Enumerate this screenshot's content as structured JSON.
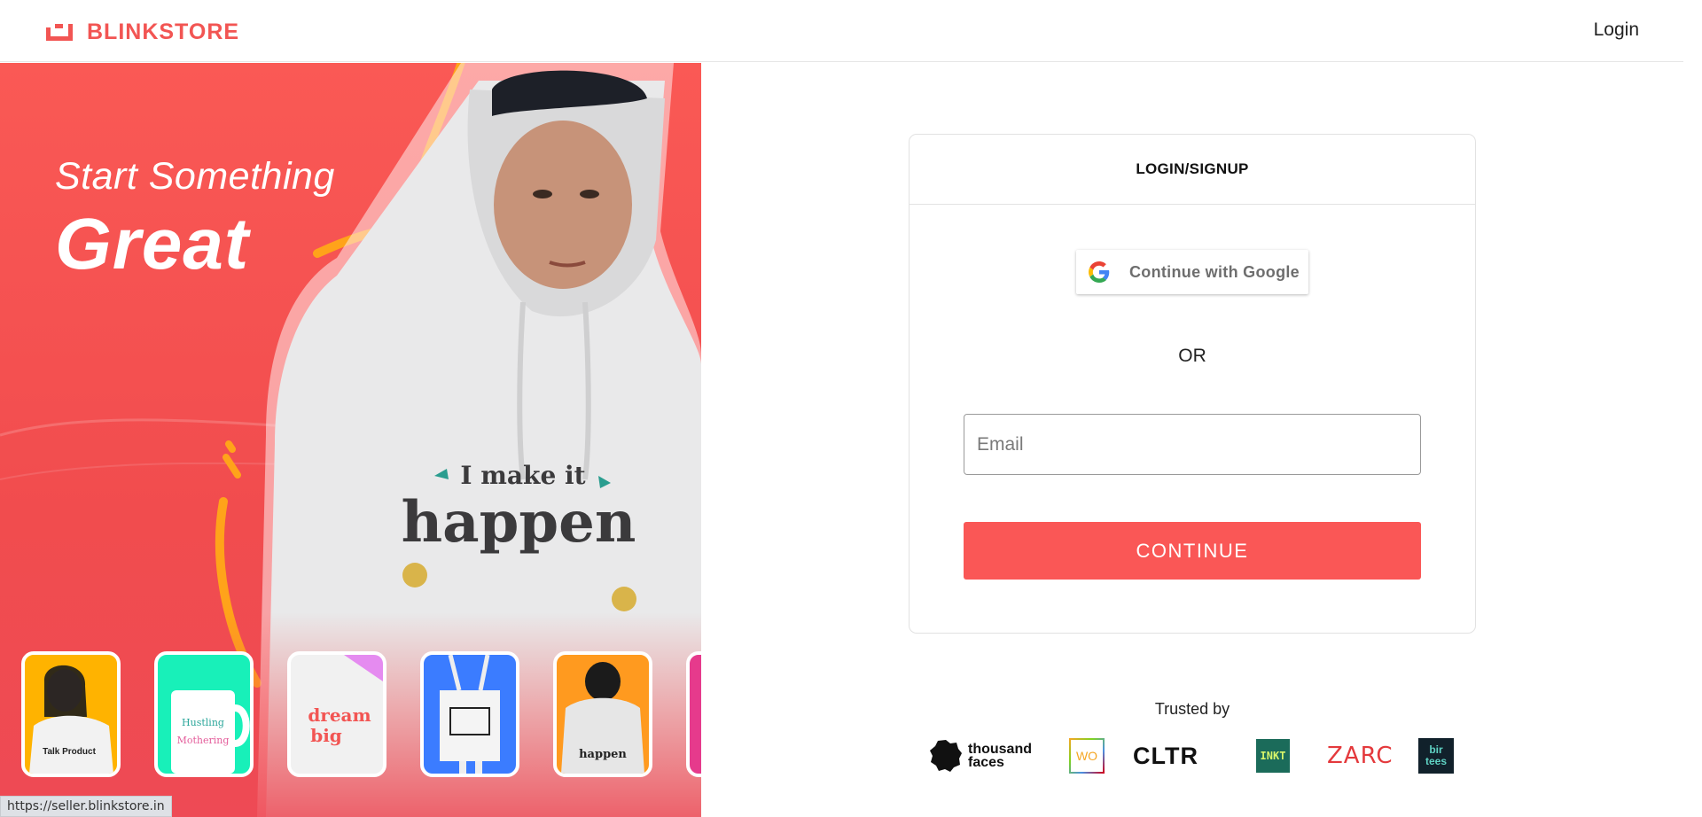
{
  "header": {
    "brand_name": "BLINKSTORE",
    "login_label": "Login",
    "brand_color": "#f25553"
  },
  "hero": {
    "subtitle": "Start Something",
    "title": "Great",
    "shirt_print_line1": "I make it",
    "shirt_print_line2": "happen",
    "background_color": "#f8524f",
    "thumbnails": [
      {
        "name": "sweatshirt-product",
        "bg": "#ffb300",
        "caption": "Talk Product to me"
      },
      {
        "name": "mug-product",
        "bg": "#18f0b9",
        "caption": "Hustling Mothering"
      },
      {
        "name": "tshirt-product",
        "bg": "#e58bf0",
        "caption": "dream big"
      },
      {
        "name": "tote-bag-product",
        "bg": "#3b7cff",
        "caption": ""
      },
      {
        "name": "back-print-product",
        "bg": "#ff9a1f",
        "caption": "happen"
      },
      {
        "name": "partial-product",
        "bg": "#e63a8c",
        "caption": ""
      }
    ]
  },
  "status_bar": {
    "url": "https://seller.blinkstore.in"
  },
  "auth_card": {
    "title": "LOGIN/SIGNUP",
    "google_label": "Continue with Google",
    "or_label": "OR",
    "email_placeholder": "Email",
    "email_value": "",
    "continue_label": "CONTINUE",
    "accent_color": "#fa5756"
  },
  "trusted": {
    "label": "Trusted by",
    "brands": [
      {
        "name": "thousand faces",
        "line1": "thousand",
        "line2": "faces"
      },
      {
        "name": "WO",
        "text": "WO"
      },
      {
        "name": "CLTR",
        "text": "CLTR"
      },
      {
        "name": "INKT",
        "text": "INKT"
      },
      {
        "name": "ZARC",
        "text": "ZARC"
      },
      {
        "name": "bir tees",
        "line1": "bir",
        "line2": "tees"
      }
    ]
  }
}
